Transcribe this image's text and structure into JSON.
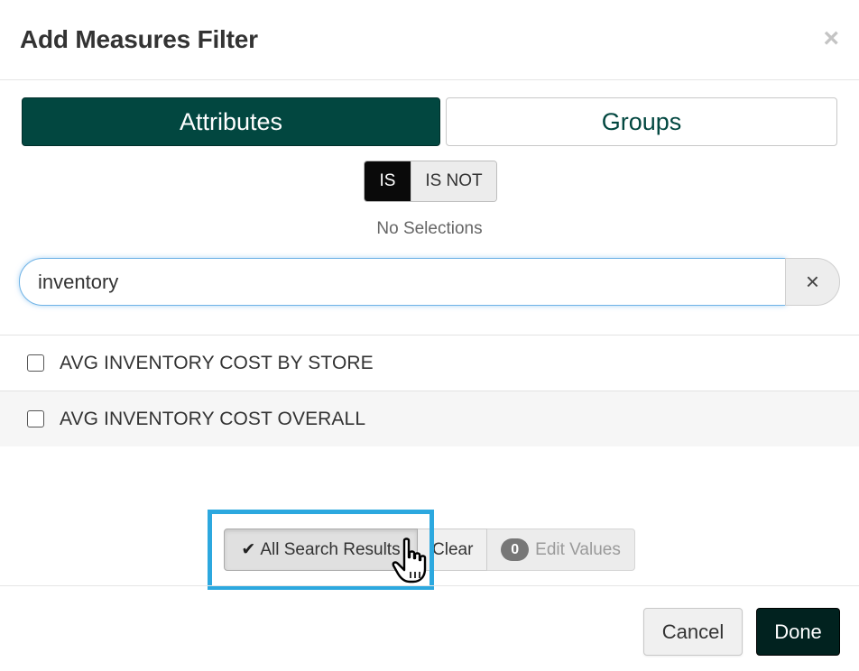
{
  "modal": {
    "title": "Add Measures Filter",
    "close_glyph": "×"
  },
  "tabs": [
    {
      "label": "Attributes",
      "active": true
    },
    {
      "label": "Groups",
      "active": false
    }
  ],
  "match_toggle": {
    "is_label": "IS",
    "is_not_label": "IS NOT",
    "selected": "IS"
  },
  "selection_status": "No Selections",
  "search": {
    "value": "inventory",
    "clear_glyph": "×"
  },
  "results": [
    {
      "label": "AVG INVENTORY COST BY STORE",
      "checked": false
    },
    {
      "label": "AVG INVENTORY COST OVERALL",
      "checked": false
    }
  ],
  "action_bar": {
    "all_search_results_label": "All Search Results",
    "clear_label": "Clear",
    "edit_values_count": "0",
    "edit_values_label": "Edit Values"
  },
  "footer": {
    "cancel_label": "Cancel",
    "done_label": "Done"
  },
  "colors": {
    "primary_dark_green": "#024740",
    "done_button": "#01221f",
    "highlight_border": "#2ca8df",
    "search_focus": "#6fb3e6"
  },
  "icons": [
    "close-icon",
    "clear-search-icon",
    "checkmark-icon",
    "hand-pointer-cursor"
  ]
}
